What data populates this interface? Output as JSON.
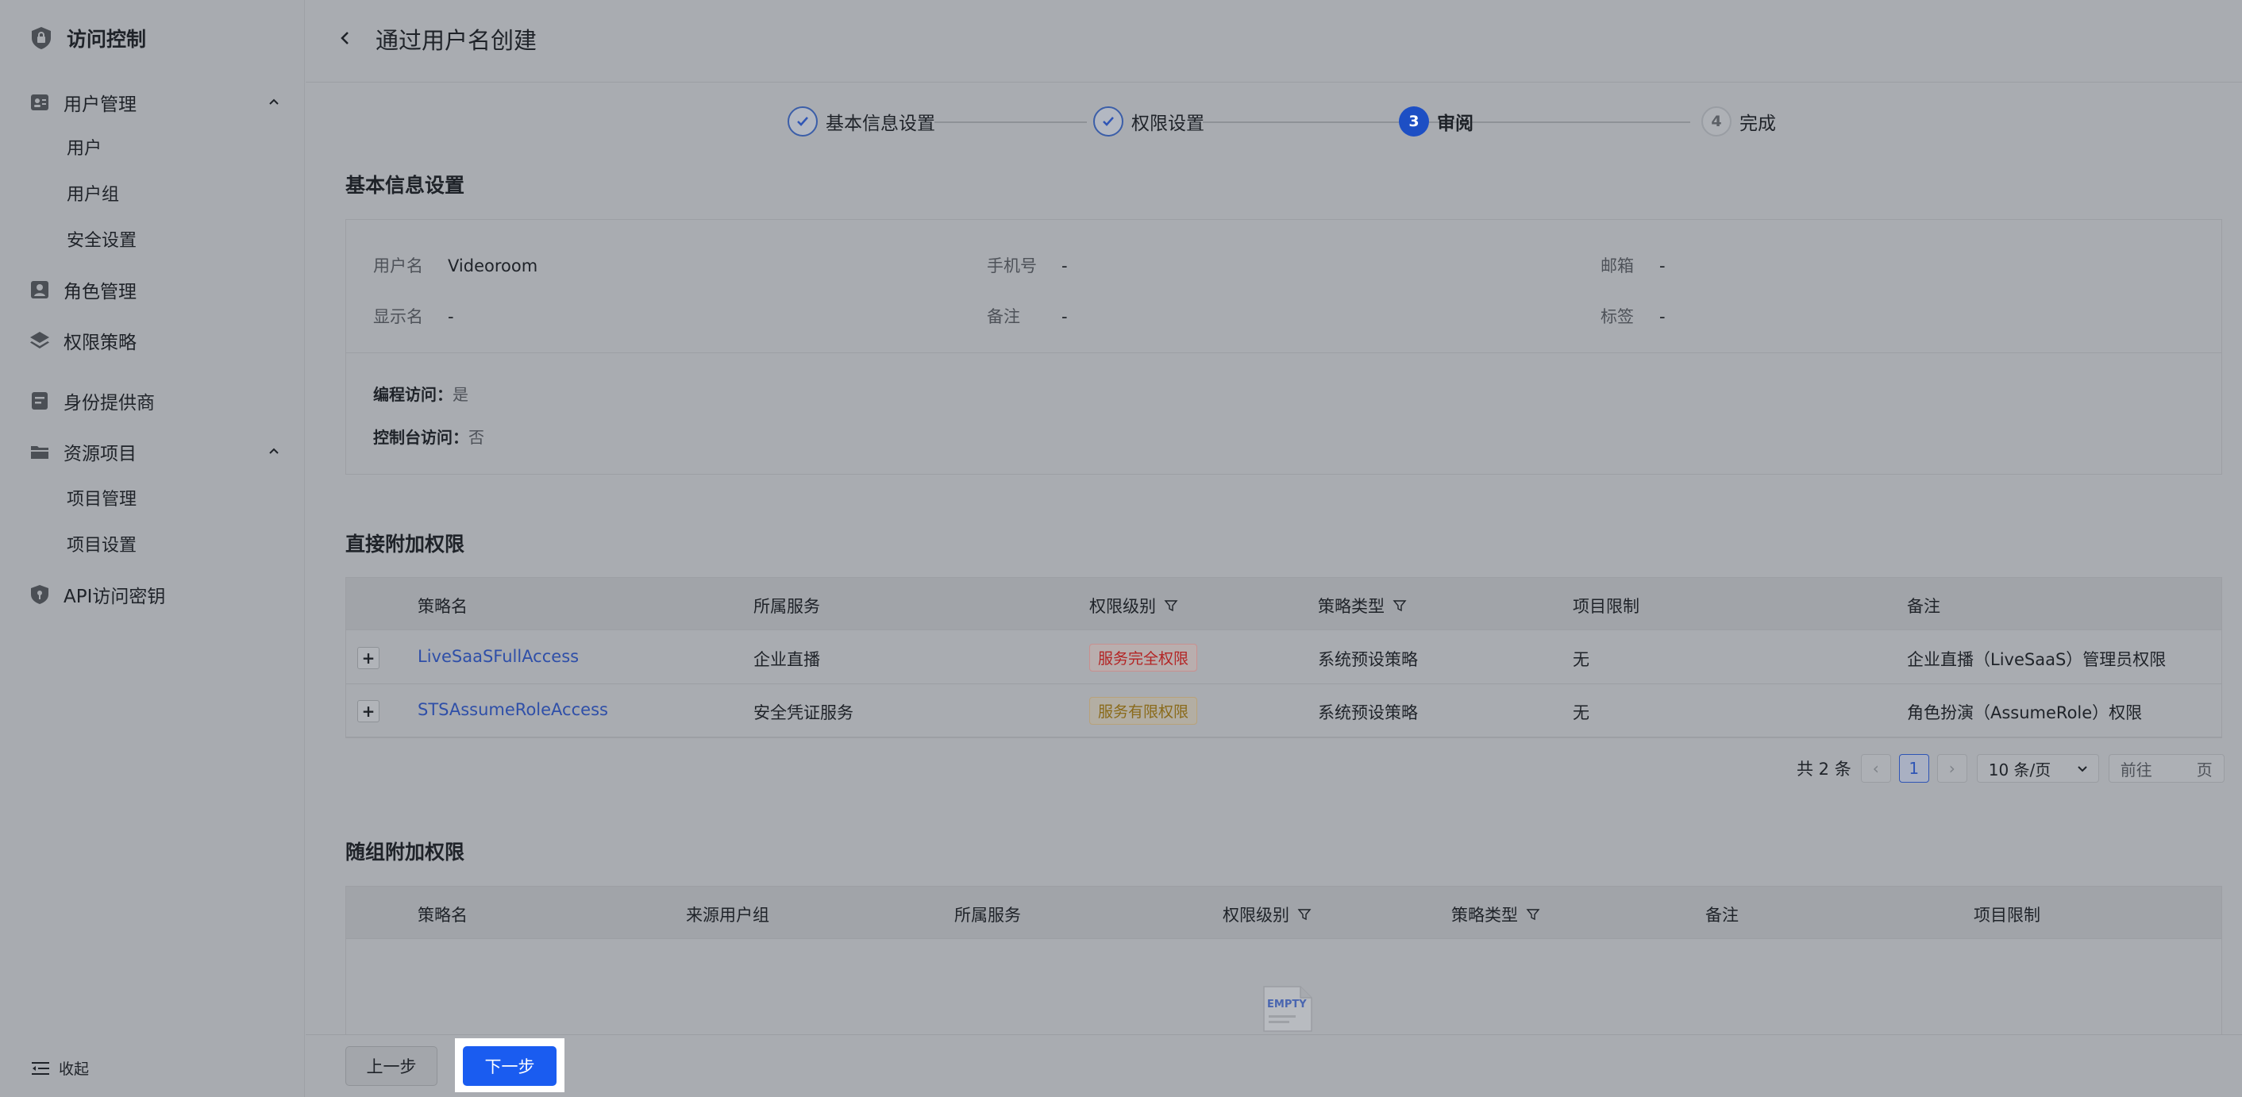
{
  "sidebar": {
    "brand_icon": "shield-lock-icon",
    "brand_title": "访问控制",
    "groups": [
      {
        "label": "用户管理",
        "icon": "user-card-icon"
      },
      {
        "label": "角色管理",
        "icon": "role-icon"
      },
      {
        "label": "权限策略",
        "icon": "layers-icon"
      },
      {
        "label": "身份提供商",
        "icon": "id-provider-icon"
      },
      {
        "label": "资源项目",
        "icon": "folder-icon"
      },
      {
        "label": "API访问密钥",
        "icon": "key-shield-icon"
      }
    ],
    "user_sub": [
      "用户",
      "用户组",
      "安全设置"
    ],
    "project_sub": [
      "项目管理",
      "项目设置"
    ],
    "collapse_label": "收起"
  },
  "header": {
    "title": "通过用户名创建"
  },
  "steps": [
    {
      "label": "基本信息设置",
      "state": "done",
      "num": ""
    },
    {
      "label": "权限设置",
      "state": "done",
      "num": ""
    },
    {
      "label": "审阅",
      "state": "active",
      "num": "3"
    },
    {
      "label": "完成",
      "state": "todo",
      "num": "4"
    }
  ],
  "basic_info": {
    "title": "基本信息设置",
    "fields": {
      "username": {
        "k": "用户名",
        "v": "Videoroom"
      },
      "phone": {
        "k": "手机号",
        "v": "-"
      },
      "email": {
        "k": "邮箱",
        "v": "-"
      },
      "display_name": {
        "k": "显示名",
        "v": "-"
      },
      "remark": {
        "k": "备注",
        "v": "-"
      },
      "tags": {
        "k": "标签",
        "v": "-"
      }
    },
    "programmatic_access": {
      "k": "编程访问：",
      "v": "是"
    },
    "console_access": {
      "k": "控制台访问：",
      "v": "否"
    }
  },
  "direct": {
    "title": "直接附加权限",
    "headers": [
      "策略名",
      "所属服务",
      "权限级别",
      "策略类型",
      "项目限制",
      "备注"
    ],
    "rows": [
      {
        "name": "LiveSaaSFullAccess",
        "service": "企业直播",
        "level": "服务完全权限",
        "type": "系统预设策略",
        "project": "无",
        "remark": "企业直播（LiveSaaS）管理员权限"
      },
      {
        "name": "STSAssumeRoleAccess",
        "service": "安全凭证服务",
        "level": "服务有限权限",
        "type": "系统预设策略",
        "project": "无",
        "remark": "角色扮演（AssumeRole）权限"
      }
    ],
    "pagination": {
      "total": "共 2 条",
      "current": "1",
      "page_size": "10 条/页",
      "goto": "前往",
      "page_unit": "页"
    }
  },
  "group": {
    "title": "随组附加权限",
    "headers": [
      "策略名",
      "来源用户组",
      "所属服务",
      "权限级别",
      "策略类型",
      "备注",
      "项目限制"
    ],
    "empty_text": "EMPTY"
  },
  "footer": {
    "prev": "上一步",
    "next": "下一步"
  },
  "colors": {
    "primary": "#1a5cf0",
    "full_tag": "#b32424",
    "limited_tag": "#8a6a1a"
  }
}
